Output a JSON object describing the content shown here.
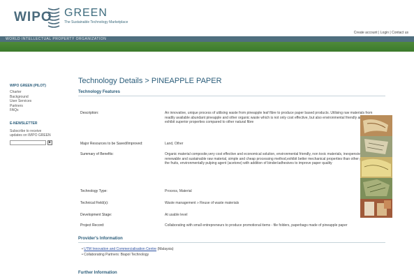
{
  "header": {
    "logo_wipo": "WIPO",
    "logo_green": "GREEN",
    "tagline": "The Sustainable Technology Marketplace",
    "org_name": "WORLD INTELLECTUAL PROPERTY ORGANIZATION",
    "links": [
      "Create account",
      "Login",
      "Contact us"
    ],
    "link_separator": " | "
  },
  "sidebar": {
    "title": "WIPO GREEN (PILOT)",
    "items": [
      "Charter",
      "Background",
      "User Services",
      "Partners",
      "FAQs"
    ],
    "newsletter_title": "E-NEWSLETTER",
    "newsletter_text": [
      "Subscribe to receive",
      "updates on WIPO GREEN"
    ],
    "submit_glyph": "►"
  },
  "main": {
    "title": "Technology Details > PINEAPPLE PAPER",
    "features_heading": "Technology Features",
    "fields": [
      {
        "label": "Description:",
        "value": "An innovative, unique process of utilising waste from pineapple leaf fibre to produce paper based products. Utilising raw materials from readily available abundant pineapple and other organic waste which is not only cost effective, but also environmental friendly and exhibit superior properties compared to other natural fibre"
      },
      {
        "label": "Major Resources to be Saved/Improved:",
        "value": "Land, Other"
      },
      {
        "label": "Summary of Benefits:",
        "value": "Organic material composite,very cost effective and economical solution, environmental friendly, non toxic materials, inexpensive renewable and sustainable raw material, simple and cheap processing method,exhibit better mechanical properties than other parts of the fruits, environmentally pulping agent (acetone) with addition of binder/adhesives to improve paper quality"
      },
      {
        "label": "Technology Type:",
        "value": "Process, Material"
      },
      {
        "label": "Technical Field(s):",
        "value": "Waste management » Reuse of waste materials"
      },
      {
        "label": "Development Stage:",
        "value": "At usable level"
      },
      {
        "label": "Project Record:",
        "value": "Collaborating with small entrepreneurs to produce promotional items - file folders, paperbags made of pineapple paper"
      }
    ],
    "provider_heading": "Provider's Information",
    "provider_link": "UTM Innovation and Commercialisation Centre",
    "provider_country": " (Malaysia)",
    "provider_partners": "Collaborating Partners: Biapol Technology",
    "further_heading": "Further Information"
  },
  "colors": {
    "accent": "#2b5d7a",
    "org_bar": "#4f6f7f",
    "green_bar": "#3b7a2b",
    "link": "#2b4fa0"
  }
}
